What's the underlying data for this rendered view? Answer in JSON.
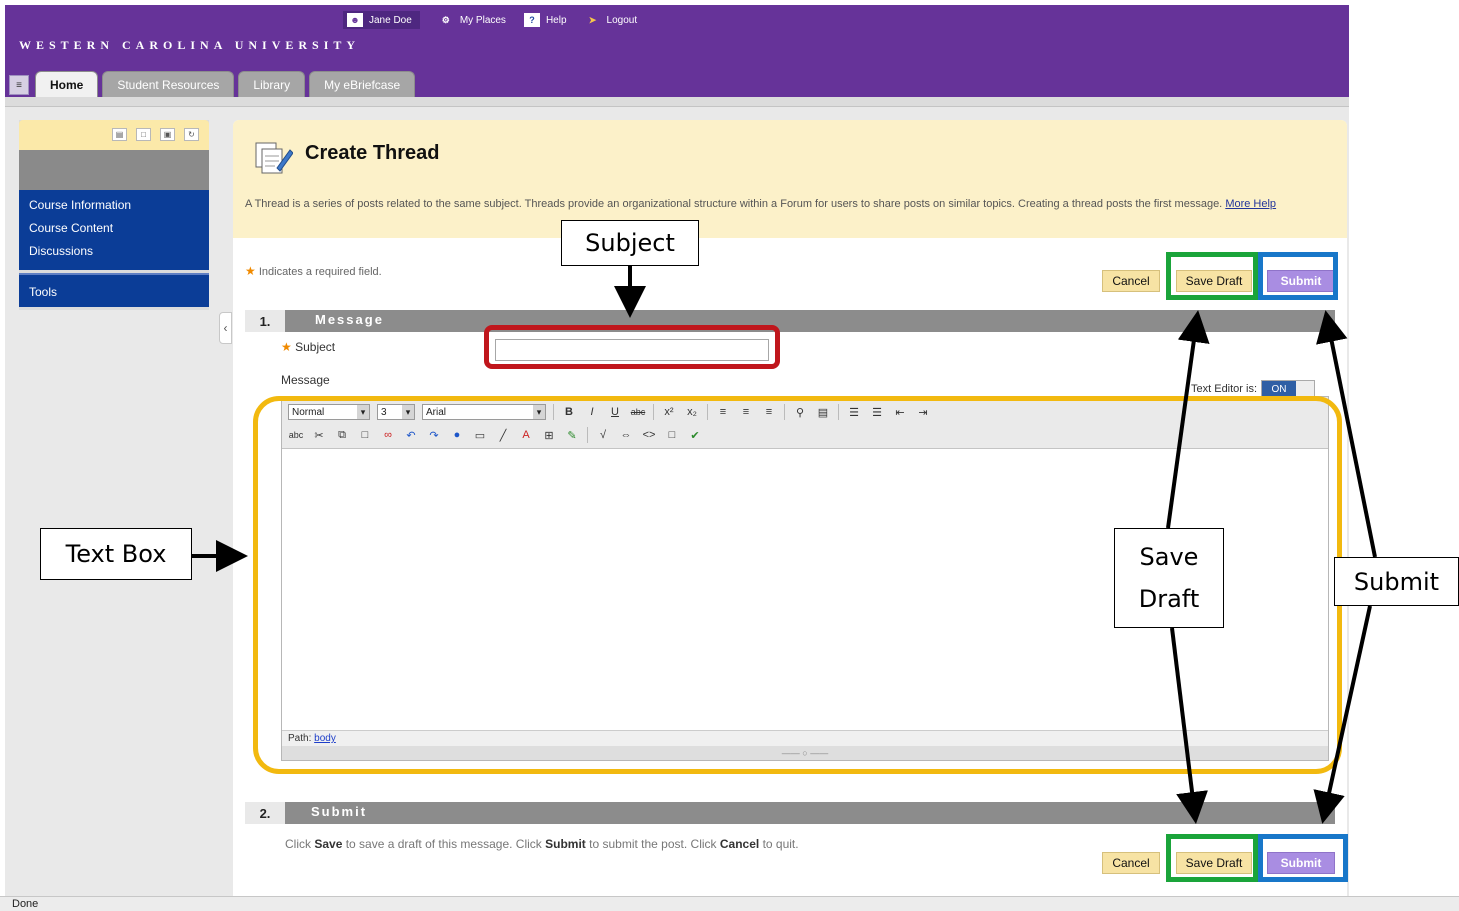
{
  "header": {
    "brand": "WESTERN CAROLINA UNIVERSITY",
    "nav": [
      {
        "label": "Jane Doe",
        "icon": "user-icon"
      },
      {
        "label": "My Places",
        "icon": "places-icon"
      },
      {
        "label": "Help",
        "icon": "help-icon"
      },
      {
        "label": "Logout",
        "icon": "logout-icon"
      }
    ],
    "tabs": [
      {
        "label": "Home",
        "active": true
      },
      {
        "label": "Student Resources"
      },
      {
        "label": "Library"
      },
      {
        "label": "My eBriefcase"
      }
    ]
  },
  "sidebar": {
    "links": [
      "Course Information",
      "Course Content",
      "Discussions"
    ],
    "tools": "Tools"
  },
  "page": {
    "title": "Create Thread",
    "intro": "A Thread is a series of posts related to the same subject. Threads provide an organizational structure within a Forum for users to share posts on similar topics. Creating a thread posts the first message.",
    "more_help": "More Help",
    "required_note": "Indicates a required field.",
    "buttons": {
      "cancel": "Cancel",
      "save_draft": "Save Draft",
      "submit": "Submit"
    },
    "section1": {
      "num": "1.",
      "title": "Message"
    },
    "subject_label": "Subject",
    "subject_value": "",
    "message_label": "Message",
    "text_editor_label": "Text Editor is:",
    "text_editor_state": "ON",
    "toolbar": {
      "format": "Normal",
      "size": "3",
      "font": "Arial"
    },
    "path_label": "Path:",
    "path_value": "body",
    "section2": {
      "num": "2.",
      "title": "Submit"
    },
    "submit_note": {
      "p1": "Click ",
      "save": "Save",
      "p2": " to save a draft of this message. Click ",
      "submit": "Submit",
      "p3": " to submit the post. Click ",
      "cancel": "Cancel",
      "p4": " to quit."
    }
  },
  "status_bar": "Done",
  "annotations": {
    "subject": "Subject",
    "text_box": "Text Box",
    "save_draft": "Save Draft",
    "submit": "Submit",
    "colors": {
      "subject": "#c0161c",
      "text_box": "#f2b90f",
      "save_draft": "#1aa43a",
      "submit": "#1877c9"
    }
  },
  "colors": {
    "header": "#663399",
    "left_menu": "#0b3d97",
    "content_header": "#fcf1c9",
    "section_bar": "#8c8c8c"
  }
}
